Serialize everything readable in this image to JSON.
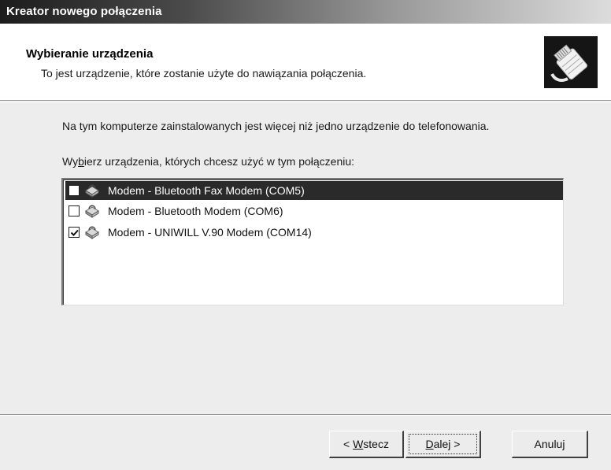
{
  "window": {
    "title": "Kreator nowego połączenia"
  },
  "header": {
    "title": "Wybieranie urządzenia",
    "subtitle": "To jest urządzenie, które zostanie użyte do nawiązania połączenia.",
    "icon": "connection-plug-icon"
  },
  "body": {
    "intro": "Na tym komputerze zainstalowanych jest więcej niż jedno urządzenie do telefonowania.",
    "prompt_pre": "Wy",
    "prompt_accel": "b",
    "prompt_post": "ierz urządzenia, których chcesz użyć w tym połączeniu:"
  },
  "devices": [
    {
      "label": "Modem - Bluetooth Fax Modem (COM5)",
      "checked": false,
      "selected": true,
      "icon": "modem-icon"
    },
    {
      "label": "Modem - Bluetooth Modem (COM6)",
      "checked": false,
      "selected": false,
      "icon": "modem-icon"
    },
    {
      "label": "Modem - UNIWILL V.90 Modem (COM14)",
      "checked": true,
      "selected": false,
      "icon": "modem-icon"
    }
  ],
  "buttons": {
    "back_pre": "< ",
    "back_accel": "W",
    "back_post": "stecz",
    "next_accel": "D",
    "next_post": "alej >",
    "cancel": "Anuluj"
  },
  "colors": {
    "selection": "#2a2a2a",
    "dialog_bg": "#ededed",
    "header_bg": "#ffffff"
  }
}
